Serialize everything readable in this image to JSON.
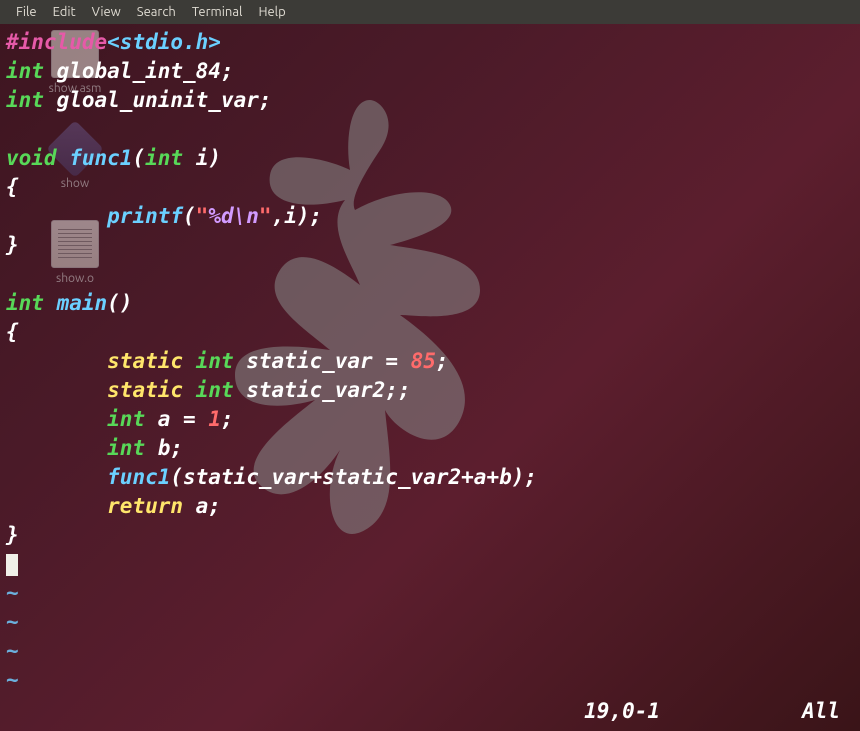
{
  "menu": {
    "file": "File",
    "edit": "Edit",
    "view": "View",
    "search": "Search",
    "terminal": "Terminal",
    "help": "Help"
  },
  "desktop": {
    "icon1": "show.asm",
    "icon2": "show",
    "icon3": "show.o"
  },
  "code": {
    "l1_preproc": "#include",
    "l1_header": "<stdio.h>",
    "l2_type": "int",
    "l2_rest": " global_int_84;",
    "l3_type": "int",
    "l3_rest": " gloal_uninit_var;",
    "l5_void": "void",
    "l5_sp": " ",
    "l5_func": "func1",
    "l5_open": "(",
    "l5_int": "int",
    "l5_rest": " i)",
    "l6": "{",
    "l7_indent": "        ",
    "l7_printf": "printf",
    "l7_open": "(",
    "l7_q1": "\"",
    "l7_fmt": "%d\\n",
    "l7_q2": "\"",
    "l7_rest": ",i);",
    "l8": "}",
    "l10_int": "int",
    "l10_sp": " ",
    "l10_main": "main",
    "l10_rest": "()",
    "l11": "{",
    "l12_indent": "        ",
    "l12_static": "static",
    "l12_sp": " ",
    "l12_int": "int",
    "l12_rest": " static_var = ",
    "l12_num": "85",
    "l12_semi": ";",
    "l13_indent": "        ",
    "l13_static": "static",
    "l13_sp": " ",
    "l13_int": "int",
    "l13_rest": " static_var2;;",
    "l14_indent": "        ",
    "l14_int": "int",
    "l14_rest": " a = ",
    "l14_num": "1",
    "l14_semi": ";",
    "l15_indent": "        ",
    "l15_int": "int",
    "l15_rest": " b;",
    "l16_indent": "        ",
    "l16_func": "func1",
    "l16_rest": "(static_var+static_var2+a+b);",
    "l17_indent": "        ",
    "l17_return": "return",
    "l17_rest": " a;",
    "l18": "}",
    "tilde": "~"
  },
  "status": {
    "position": "19,0-1",
    "percent": "All"
  }
}
